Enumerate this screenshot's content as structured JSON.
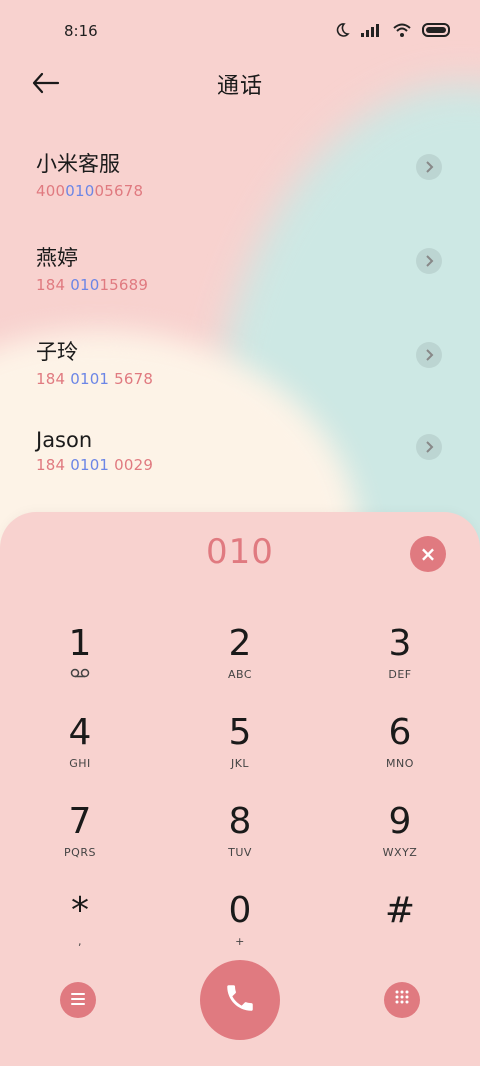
{
  "status": {
    "time": "8:16",
    "icons": [
      "moon-icon",
      "signal-icon",
      "wifi-icon",
      "battery-icon"
    ]
  },
  "header": {
    "title": "通话",
    "back_icon": "arrow-left-icon"
  },
  "contacts": [
    {
      "name": "小米客服",
      "num_pre": "400",
      "num_hl": "010",
      "num_post": "05678"
    },
    {
      "name": "燕婷",
      "num_pre": "184 ",
      "num_hl": "010",
      "num_post": "15689"
    },
    {
      "name": "子玲",
      "num_pre": "184 ",
      "num_hl": "0101",
      "num_post": " 5678"
    },
    {
      "name": "Jason",
      "num_pre": "184 ",
      "num_hl": "0101",
      "num_post": " 0029"
    }
  ],
  "dialer": {
    "dialed": "010",
    "clear_label": "×",
    "keys": [
      {
        "digit": "1",
        "sub": ""
      },
      {
        "digit": "2",
        "sub": "ABC"
      },
      {
        "digit": "3",
        "sub": "DEF"
      },
      {
        "digit": "4",
        "sub": "GHI"
      },
      {
        "digit": "5",
        "sub": "JKL"
      },
      {
        "digit": "6",
        "sub": "MNO"
      },
      {
        "digit": "7",
        "sub": "PQRS"
      },
      {
        "digit": "8",
        "sub": "TUV"
      },
      {
        "digit": "9",
        "sub": "WXYZ"
      },
      {
        "digit": "*",
        "sub": ","
      },
      {
        "digit": "0",
        "sub": "+"
      },
      {
        "digit": "#",
        "sub": ""
      }
    ],
    "bottom": {
      "menu_icon": "menu-icon",
      "call_icon": "phone-icon",
      "keypad_icon": "keypad-icon"
    }
  },
  "colors": {
    "accent": "#e07a80",
    "highlight": "#6c86e6",
    "background": "#f8d2cf",
    "teal": "#cde8e4",
    "cream": "#fdf3e7"
  }
}
